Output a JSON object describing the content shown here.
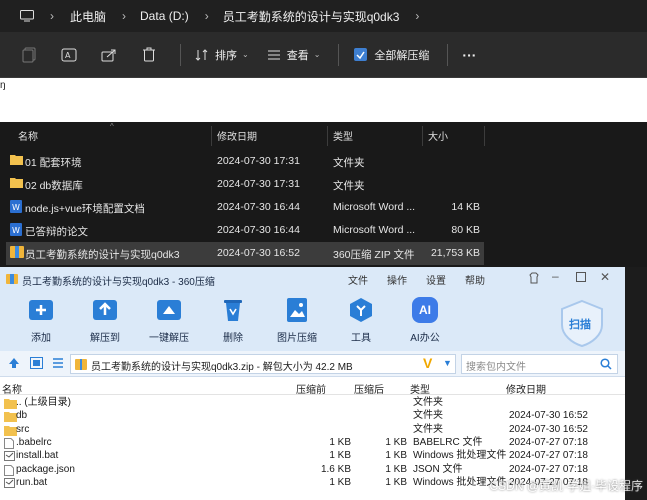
{
  "explorer": {
    "breadcrumb": [
      "此电脑",
      "Data (D:)",
      "员工考勤系统的设计与实现q0dk3"
    ],
    "toolbar": {
      "sort_label": "排序",
      "view_label": "查看",
      "extract_all_label": "全部解压缩",
      "more_label": "···"
    },
    "strip_text": "ŋ",
    "columns": [
      "名称",
      "修改日期",
      "类型",
      "大小"
    ],
    "files": [
      {
        "name": "01 配套环境",
        "date": "2024-07-30 17:31",
        "type": "文件夹",
        "size": "",
        "icon": "folder-icon"
      },
      {
        "name": "02 db数据库",
        "date": "2024-07-30 17:31",
        "type": "文件夹",
        "size": "",
        "icon": "folder-icon"
      },
      {
        "name": "node.js+vue环境配置文档",
        "date": "2024-07-30 16:44",
        "type": "Microsoft Word ...",
        "size": "14 KB",
        "icon": "word-icon"
      },
      {
        "name": "已答辩的论文",
        "date": "2024-07-30 16:44",
        "type": "Microsoft Word ...",
        "size": "80 KB",
        "icon": "word-icon"
      },
      {
        "name": "员工考勤系统的设计与实现q0dk3",
        "date": "2024-07-30 16:52",
        "type": "360压缩 ZIP 文件",
        "size": "21,753 KB",
        "icon": "zip-icon",
        "selected": true
      }
    ]
  },
  "zip": {
    "title": "员工考勤系统的设计与实现q0dk3 - 360压缩",
    "menu": [
      "文件",
      "操作",
      "设置",
      "帮助"
    ],
    "tools": [
      "添加",
      "解压到",
      "一键解压",
      "删除",
      "图片压缩",
      "工具",
      "AI办公"
    ],
    "ai_badge": "AI",
    "scan_label": "扫描",
    "path_text": "员工考勤系统的设计与实现q0dk3.zip - 解包大小为 42.2 MB",
    "search_placeholder": "搜索包内文件",
    "columns": [
      "名称",
      "压缩前",
      "压缩后",
      "类型",
      "修改日期"
    ],
    "entries": [
      {
        "name": ".. (上级目录)",
        "before": "",
        "after": "",
        "type": "文件夹",
        "date": "",
        "icon": "folder-icon"
      },
      {
        "name": "db",
        "before": "",
        "after": "",
        "type": "文件夹",
        "date": "2024-07-30 16:52",
        "icon": "folder-icon"
      },
      {
        "name": "src",
        "before": "",
        "after": "",
        "type": "文件夹",
        "date": "2024-07-30 16:52",
        "icon": "folder-icon"
      },
      {
        "name": ".babelrc",
        "before": "1 KB",
        "after": "1 KB",
        "type": "BABELRC 文件",
        "date": "2024-07-27 07:18",
        "icon": "file-icon"
      },
      {
        "name": "install.bat",
        "before": "1 KB",
        "after": "1 KB",
        "type": "Windows 批处理文件",
        "date": "2024-07-27 07:18",
        "icon": "bat-icon"
      },
      {
        "name": "package.json",
        "before": "1.6 KB",
        "after": "1 KB",
        "type": "JSON 文件",
        "date": "2024-07-27 07:18",
        "icon": "file-icon"
      },
      {
        "name": "run.bat",
        "before": "1 KB",
        "after": "1 KB",
        "type": "Windows 批处理文件",
        "date": "2024-07-27 07:18",
        "icon": "bat-icon"
      }
    ]
  },
  "watermark": "CSDN @黄凯·学姐·毕设程序",
  "colors": {
    "folder": "#f2c14e",
    "accent": "#2a7ed6",
    "selection": "#3c3c3c"
  }
}
